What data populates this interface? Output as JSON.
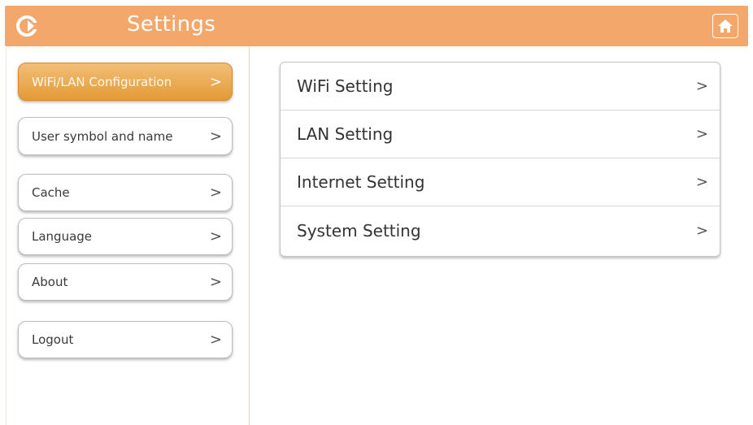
{
  "header": {
    "title": "Settings",
    "back_icon": "back-arrow-icon",
    "home_icon": "home-icon",
    "color": "#f3a76a"
  },
  "sidebar": {
    "items": [
      {
        "label": "WiFi/LAN Configuration",
        "active": true
      },
      {
        "label": "User symbol and name",
        "active": false
      },
      {
        "label": "Cache",
        "active": false
      },
      {
        "label": "Language",
        "active": false
      },
      {
        "label": "About",
        "active": false
      },
      {
        "label": "Logout",
        "active": false
      }
    ],
    "chevron": ">"
  },
  "panel": {
    "rows": [
      {
        "label": "WiFi Setting"
      },
      {
        "label": "LAN Setting"
      },
      {
        "label": "Internet Setting"
      },
      {
        "label": "System Setting"
      }
    ],
    "chevron": ">"
  }
}
